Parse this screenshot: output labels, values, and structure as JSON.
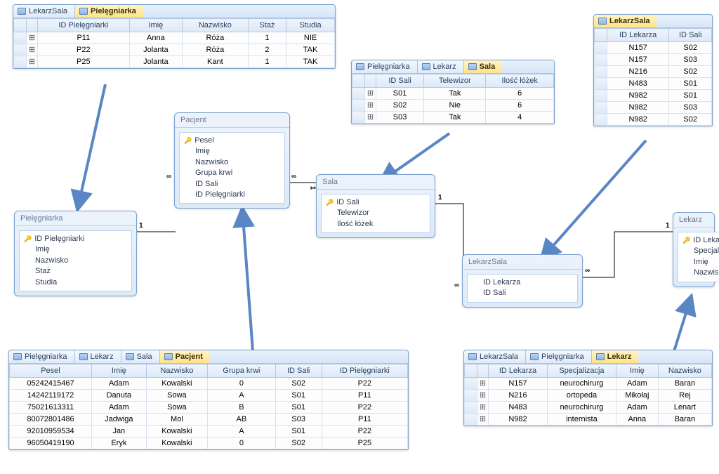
{
  "ds_pielegniarka": {
    "tabs": [
      {
        "label": "LekarzSala",
        "active": false
      },
      {
        "label": "Pielęgniarka",
        "active": true
      }
    ],
    "columns": [
      "ID Pielęgniarki",
      "Imię",
      "Nazwisko",
      "Staż",
      "Studia"
    ],
    "rows": [
      [
        "P11",
        "Anna",
        "Róża",
        "1",
        "NIE"
      ],
      [
        "P22",
        "Jolanta",
        "Róża",
        "2",
        "TAK"
      ],
      [
        "P25",
        "Jolanta",
        "Kant",
        "1",
        "TAK"
      ]
    ]
  },
  "ds_sala": {
    "tabs": [
      {
        "label": "Pielęgniarka",
        "active": false
      },
      {
        "label": "Lekarz",
        "active": false
      },
      {
        "label": "Sala",
        "active": true
      }
    ],
    "columns": [
      "ID Sali",
      "Telewizor",
      "Ilość łóżek"
    ],
    "rows": [
      [
        "S01",
        "Tak",
        "6"
      ],
      [
        "S02",
        "Nie",
        "6"
      ],
      [
        "S03",
        "Tak",
        "4"
      ]
    ]
  },
  "ds_lekarzsala": {
    "tabs": [
      {
        "label": "LekarzSala",
        "active": true
      }
    ],
    "columns": [
      "ID Lekarza",
      "ID Sali"
    ],
    "rows": [
      [
        "N157",
        "S02"
      ],
      [
        "N157",
        "S03"
      ],
      [
        "N216",
        "S02"
      ],
      [
        "N483",
        "S01"
      ],
      [
        "N982",
        "S01"
      ],
      [
        "N982",
        "S03"
      ],
      [
        "N982",
        "S02"
      ]
    ]
  },
  "ds_pacjent": {
    "tabs": [
      {
        "label": "Pielęgniarka",
        "active": false
      },
      {
        "label": "Lekarz",
        "active": false
      },
      {
        "label": "Sala",
        "active": false
      },
      {
        "label": "Pacjent",
        "active": true
      }
    ],
    "columns": [
      "Pesel",
      "Imię",
      "Nazwisko",
      "Grupa krwi",
      "ID Sali",
      "ID Pielęgniarki"
    ],
    "rows": [
      [
        "05242415467",
        "Adam",
        "Kowalski",
        "0",
        "S02",
        "P22"
      ],
      [
        "14242119172",
        "Danuta",
        "Sowa",
        "A",
        "S01",
        "P11"
      ],
      [
        "75021613311",
        "Adam",
        "Sowa",
        "B",
        "S01",
        "P22"
      ],
      [
        "80072801486",
        "Jadwiga",
        "Mol",
        "AB",
        "S03",
        "P11"
      ],
      [
        "92010959534",
        "Jan",
        "Kowalski",
        "A",
        "S01",
        "P22"
      ],
      [
        "96050419190",
        "Eryk",
        "Kowalski",
        "0",
        "S02",
        "P25"
      ]
    ]
  },
  "ds_lekarz": {
    "tabs": [
      {
        "label": "LekarzSala",
        "active": false
      },
      {
        "label": "Pielęgniarka",
        "active": false
      },
      {
        "label": "Lekarz",
        "active": true
      }
    ],
    "columns": [
      "ID Lekarza",
      "Specjalizacja",
      "Imię",
      "Nazwisko"
    ],
    "rows": [
      [
        "N157",
        "neurochirurg",
        "Adam",
        "Baran"
      ],
      [
        "N216",
        "ortopeda",
        "Mikołaj",
        "Rej"
      ],
      [
        "N483",
        "neurochirurg",
        "Adam",
        "Lenart"
      ],
      [
        "N982",
        "internista",
        "Anna",
        "Baran"
      ]
    ]
  },
  "entities": {
    "pacjent": {
      "title": "Pacjent",
      "fields": [
        {
          "name": "Pesel",
          "key": true
        },
        {
          "name": "Imię",
          "key": false
        },
        {
          "name": "Nazwisko",
          "key": false
        },
        {
          "name": "Grupa krwi",
          "key": false
        },
        {
          "name": "ID Sali",
          "key": false
        },
        {
          "name": "ID Pielęgniarki",
          "key": false
        }
      ]
    },
    "sala": {
      "title": "Sala",
      "fields": [
        {
          "name": "ID Sali",
          "key": true
        },
        {
          "name": "Telewizor",
          "key": false
        },
        {
          "name": "Ilość łóżek",
          "key": false
        }
      ]
    },
    "pielegniarka": {
      "title": "Pielęgniarka",
      "fields": [
        {
          "name": "ID Pielęgniarki",
          "key": true
        },
        {
          "name": "Imię",
          "key": false
        },
        {
          "name": "Nazwisko",
          "key": false
        },
        {
          "name": "Staż",
          "key": false
        },
        {
          "name": "Studia",
          "key": false
        }
      ]
    },
    "lekarzsala": {
      "title": "LekarzSala",
      "fields": [
        {
          "name": "ID Lekarza",
          "key": false
        },
        {
          "name": "ID Sali",
          "key": false
        }
      ]
    },
    "lekarz": {
      "title": "Lekarz",
      "fields": [
        {
          "name": "ID Lekarza",
          "key": true
        },
        {
          "name": "Specjalizacja",
          "key": false
        },
        {
          "name": "Imię",
          "key": false
        },
        {
          "name": "Nazwisko",
          "key": false
        }
      ]
    }
  },
  "relationships": {
    "one": "1",
    "many": "∞"
  }
}
